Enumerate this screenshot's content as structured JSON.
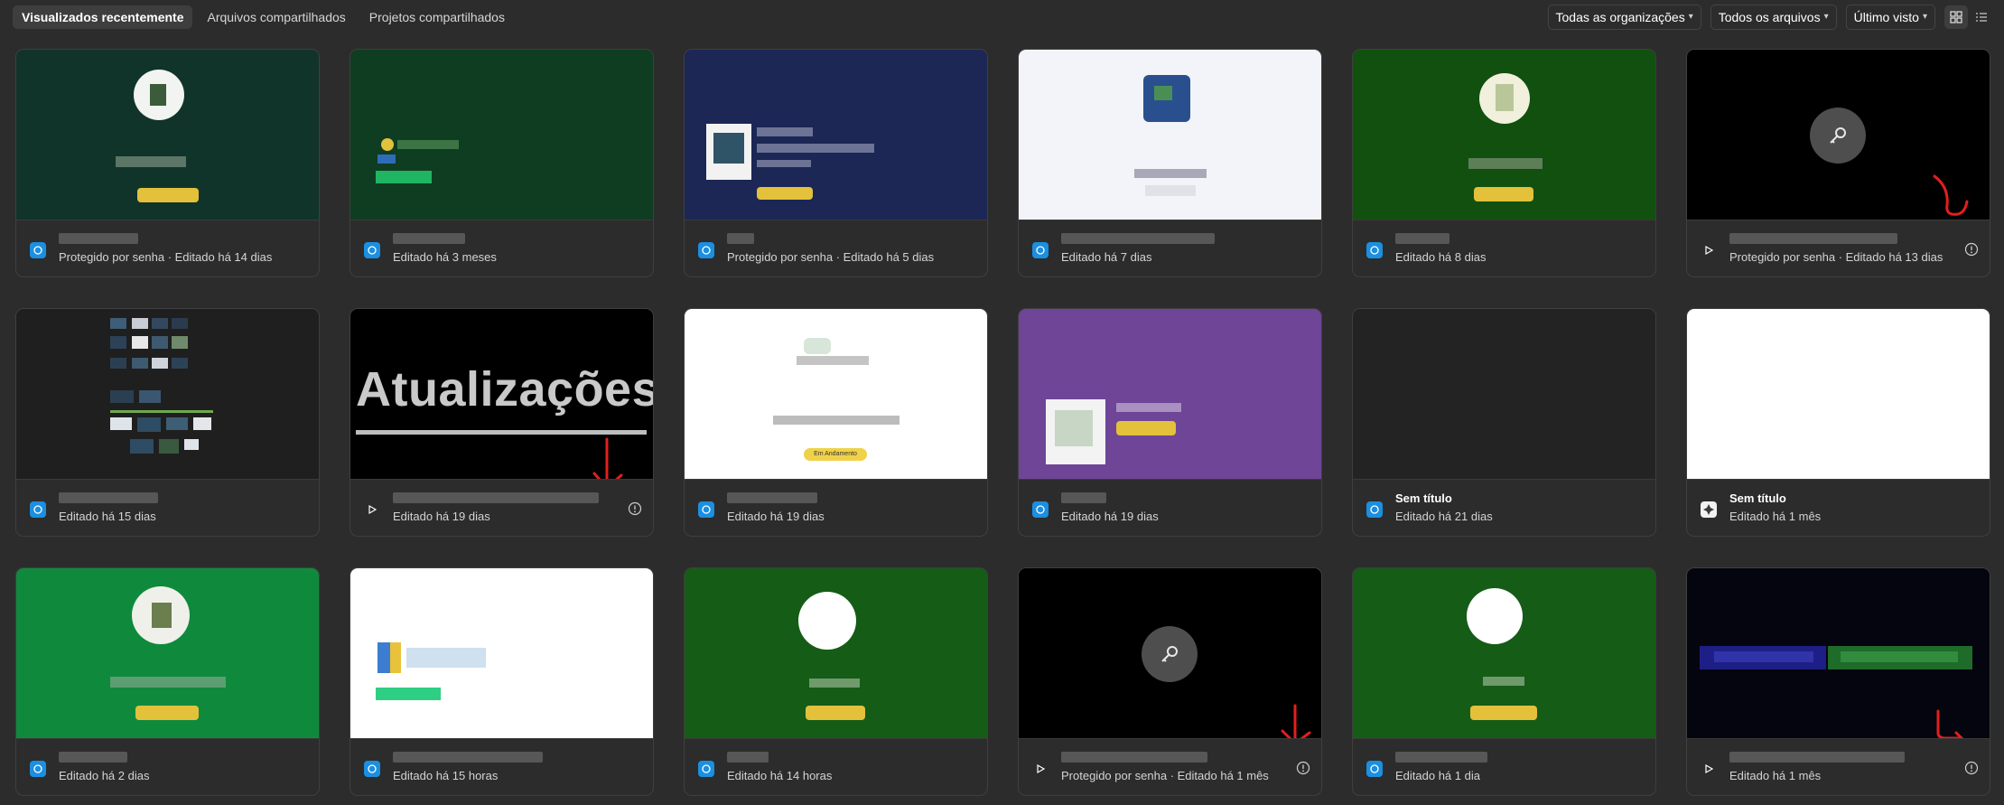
{
  "tabs": [
    {
      "label": "Visualizados recentemente",
      "active": true
    },
    {
      "label": "Arquivos compartilhados",
      "active": false
    },
    {
      "label": "Projetos compartilhados",
      "active": false
    }
  ],
  "filters": {
    "organizations": "Todas as organizações",
    "files": "Todos os arquivos",
    "sort": "Último visto"
  },
  "colors": {
    "accent": "#1b8fe0",
    "annotation": "#e0201e",
    "badge_yellow": "#e3c13b"
  },
  "cards": [
    {
      "icon": "figma-file-icon",
      "name": "",
      "status": "Protegido por senha · Editado há 14 dias"
    },
    {
      "icon": "figma-file-icon",
      "name": "",
      "status": "Editado há 3 meses"
    },
    {
      "icon": "figma-file-icon",
      "name": "",
      "status": "Protegido por senha · Editado há 5 dias"
    },
    {
      "icon": "figma-file-icon",
      "name": "",
      "status": "Editado há 7 dias"
    },
    {
      "icon": "figma-file-icon",
      "name": "",
      "status": "Editado há 8 dias"
    },
    {
      "icon": "prototype-play-icon",
      "name": "",
      "status": "Protegido por senha · Editado há 13 dias"
    },
    {
      "icon": "figma-file-icon",
      "name": "",
      "status": "Editado há 15 dias"
    },
    {
      "icon": "prototype-play-icon",
      "name": "",
      "status": "Editado há 19 dias",
      "thumb_text": "Atualizações"
    },
    {
      "icon": "figma-file-icon",
      "name": "",
      "status": "Editado há 19 dias",
      "badge": "Em Andamento"
    },
    {
      "icon": "figma-file-icon",
      "name": "",
      "status": "Editado há 19 dias"
    },
    {
      "icon": "figma-file-icon",
      "name": "Sem título",
      "status": "Editado há 21 dias"
    },
    {
      "icon": "figjam-file-icon",
      "name": "Sem título",
      "status": "Editado há 1 mês"
    },
    {
      "icon": "figma-file-icon",
      "name": "",
      "status": "Editado há 2 dias"
    },
    {
      "icon": "figma-file-icon",
      "name": "",
      "status": "Editado há 15 horas"
    },
    {
      "icon": "figma-file-icon",
      "name": "",
      "status": "Editado há 14 horas"
    },
    {
      "icon": "prototype-play-icon",
      "name": "",
      "status": "Protegido por senha · Editado há 1 mês"
    },
    {
      "icon": "figma-file-icon",
      "name": "",
      "status": "Editado há 1 dia"
    },
    {
      "icon": "prototype-play-icon",
      "name": "",
      "status": "Editado há 1 mês"
    }
  ]
}
